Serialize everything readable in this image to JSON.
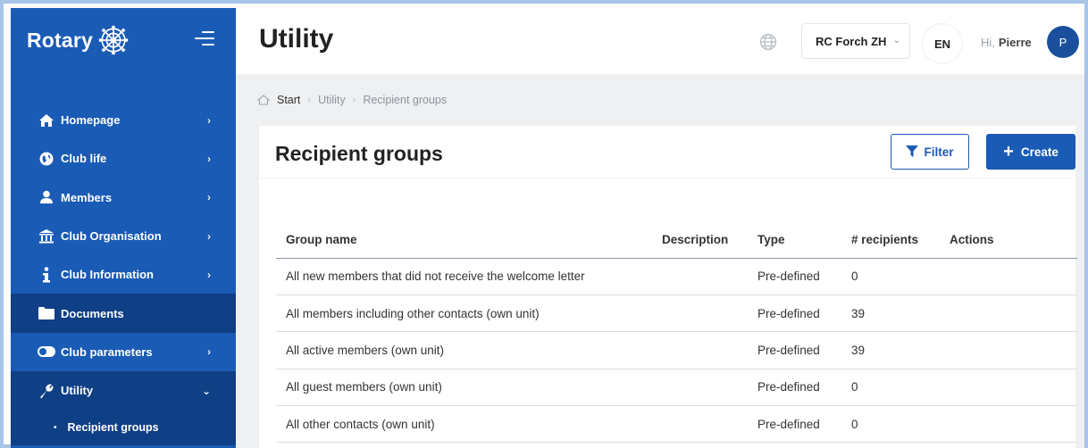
{
  "brand": {
    "logo_text": "Rotary"
  },
  "sidebar": {
    "items": [
      {
        "label": "Homepage",
        "icon": "home-icon",
        "chevron": "›"
      },
      {
        "label": "Club life",
        "icon": "globe-icon",
        "chevron": "›"
      },
      {
        "label": "Members",
        "icon": "user-icon",
        "chevron": "›"
      },
      {
        "label": "Club Organisation",
        "icon": "institution-icon",
        "chevron": "›"
      },
      {
        "label": "Club Information",
        "icon": "info-icon",
        "chevron": "›"
      },
      {
        "label": "Documents",
        "icon": "folder-icon",
        "chevron": ""
      },
      {
        "label": "Club parameters",
        "icon": "toggle-icon",
        "chevron": "›"
      },
      {
        "label": "Utility",
        "icon": "wrench-icon",
        "chevron": "⌄"
      }
    ],
    "subitems": [
      {
        "label": "Recipient groups"
      }
    ]
  },
  "header": {
    "title": "Utility",
    "club_select": "RC Forch ZH",
    "language": "EN",
    "greeting": "Hi,",
    "user_name": "Pierre",
    "avatar_initial": "P"
  },
  "breadcrumb": {
    "items": [
      "Start",
      "Utility",
      "Recipient groups"
    ]
  },
  "card": {
    "title": "Recipient groups",
    "filter_label": "Filter",
    "create_label": "Create"
  },
  "table": {
    "columns": [
      "Group name",
      "Description",
      "Type",
      "# recipients",
      "Actions"
    ],
    "rows": [
      {
        "name": "All new members that did not receive the welcome letter",
        "description": "",
        "type": "Pre-defined",
        "recipients": "0"
      },
      {
        "name": "All members including other contacts (own unit)",
        "description": "",
        "type": "Pre-defined",
        "recipients": "39"
      },
      {
        "name": "All active members (own unit)",
        "description": "",
        "type": "Pre-defined",
        "recipients": "39"
      },
      {
        "name": "All guest members (own unit)",
        "description": "",
        "type": "Pre-defined",
        "recipients": "0"
      },
      {
        "name": "All other contacts (own unit)",
        "description": "",
        "type": "Pre-defined",
        "recipients": "0"
      }
    ]
  },
  "colors": {
    "sidebar": "#1a5bb5",
    "sidebar_active": "#0f3f85",
    "accent": "#1a5bb5",
    "avatar": "#1a4f9c"
  }
}
